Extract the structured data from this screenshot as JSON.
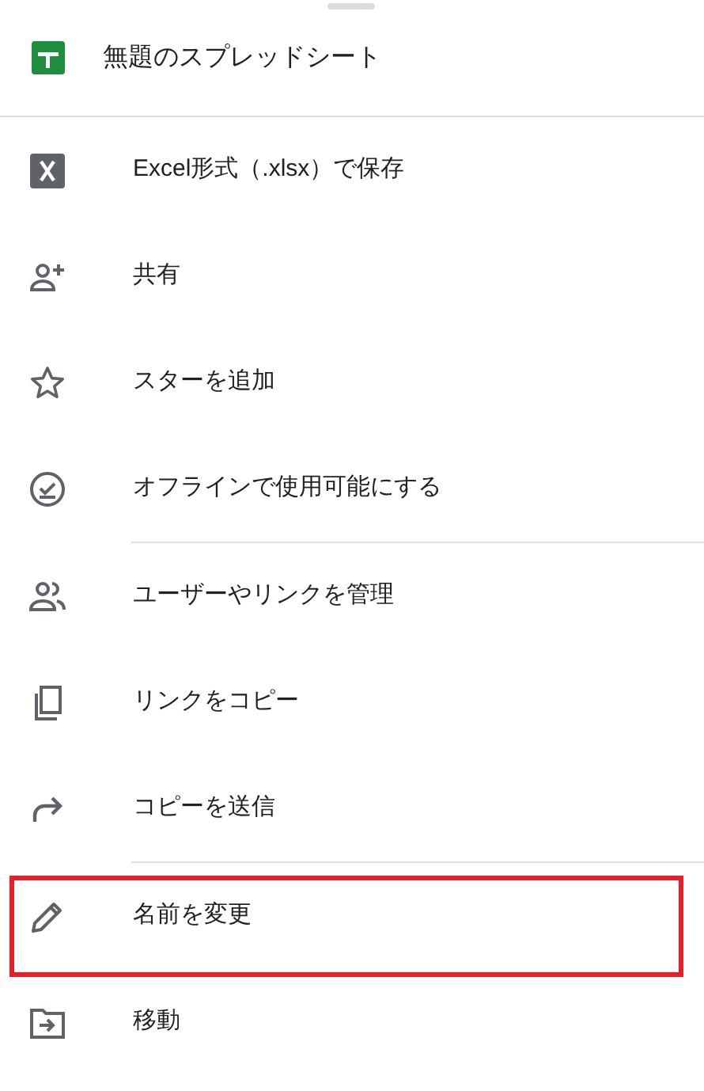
{
  "header": {
    "title": "無題のスプレッドシート"
  },
  "items": [
    {
      "kind": "excel",
      "label": "Excel形式（.xlsx）で保存",
      "divider_after": false,
      "highlighted": false
    },
    {
      "kind": "share",
      "label": "共有",
      "divider_after": false,
      "highlighted": false
    },
    {
      "kind": "star",
      "label": "スターを追加",
      "divider_after": false,
      "highlighted": false
    },
    {
      "kind": "offline",
      "label": "オフラインで使用可能にする",
      "divider_after": true,
      "highlighted": false
    },
    {
      "kind": "people",
      "label": "ユーザーやリンクを管理",
      "divider_after": false,
      "highlighted": false
    },
    {
      "kind": "copy",
      "label": "リンクをコピー",
      "divider_after": false,
      "highlighted": false
    },
    {
      "kind": "send",
      "label": "コピーを送信",
      "divider_after": true,
      "highlighted": false
    },
    {
      "kind": "rename",
      "label": "名前を変更",
      "divider_after": false,
      "highlighted": true
    },
    {
      "kind": "move",
      "label": "移動",
      "divider_after": false,
      "highlighted": false
    }
  ]
}
